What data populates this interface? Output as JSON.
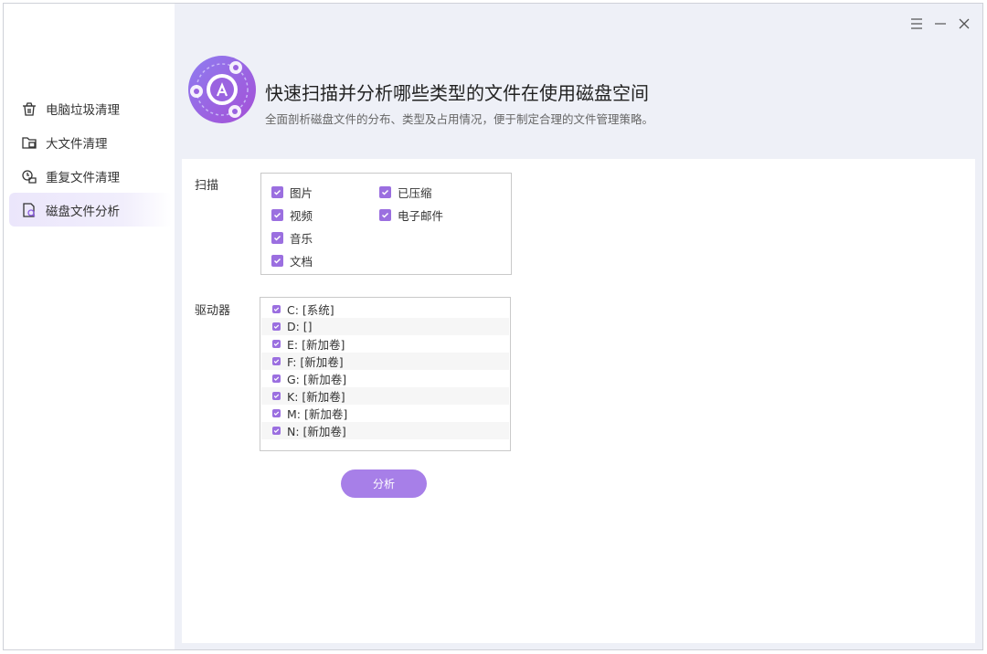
{
  "sidebar": {
    "items": [
      {
        "label": "电脑垃圾清理",
        "icon": "trash-bin-icon"
      },
      {
        "label": "大文件清理",
        "icon": "large-file-icon"
      },
      {
        "label": "重复文件清理",
        "icon": "duplicate-file-icon"
      },
      {
        "label": "磁盘文件分析",
        "icon": "disk-analysis-icon",
        "active": true
      }
    ]
  },
  "window_controls": {
    "menu": "menu-icon",
    "minimize": "minimize-icon",
    "close": "close-icon"
  },
  "header": {
    "title": "快速扫描并分析哪些类型的文件在使用磁盘空间",
    "subtitle": "全面剖析磁盘文件的分布、类型及占用情况，便于制定合理的文件管理策略。"
  },
  "scan": {
    "label": "扫描",
    "options": [
      {
        "label": "图片",
        "checked": true
      },
      {
        "label": "已压缩",
        "checked": true
      },
      {
        "label": "视频",
        "checked": true
      },
      {
        "label": "电子邮件",
        "checked": true
      },
      {
        "label": "音乐",
        "checked": true
      },
      {
        "label": "文档",
        "checked": true
      }
    ]
  },
  "drives": {
    "label": "驱动器",
    "items": [
      {
        "label": "C: [系统]",
        "checked": true
      },
      {
        "label": "D: []",
        "checked": true
      },
      {
        "label": "E: [新加卷]",
        "checked": true
      },
      {
        "label": "F: [新加卷]",
        "checked": true
      },
      {
        "label": "G: [新加卷]",
        "checked": true
      },
      {
        "label": "K: [新加卷]",
        "checked": true
      },
      {
        "label": "M: [新加卷]",
        "checked": true
      },
      {
        "label": "N: [新加卷]",
        "checked": true
      }
    ]
  },
  "analyze_button": "分析",
  "colors": {
    "accent": "#9b6fe0",
    "button": "#a77fe8",
    "header_bg": "#eef0f7",
    "active_nav": "#ebe6fb"
  }
}
